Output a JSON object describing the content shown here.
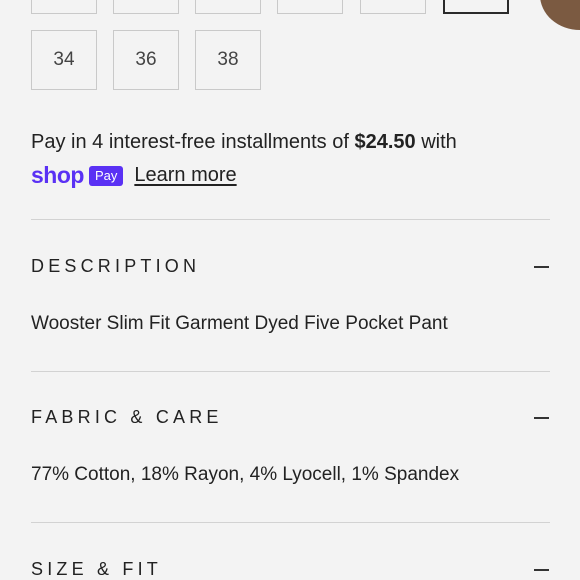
{
  "sizes": [
    "34",
    "36",
    "38"
  ],
  "payment": {
    "installment_prefix": "Pay in 4 interest-free installments of ",
    "installment_amount": "$24.50",
    "installment_suffix": " with",
    "shop_word": "shop",
    "pay_badge": "Pay",
    "learn_more": "Learn more",
    "brand_color": "#5a31f4"
  },
  "accordion": [
    {
      "title": "DESCRIPTION",
      "icon": "minus-icon",
      "body": "Wooster Slim Fit Garment Dyed Five Pocket Pant"
    },
    {
      "title": "FABRIC & CARE",
      "icon": "minus-icon",
      "body": "77% Cotton, 18% Rayon, 4% Lyocell, 1% Spandex"
    },
    {
      "title": "SIZE & FIT",
      "icon": "minus-icon"
    }
  ]
}
